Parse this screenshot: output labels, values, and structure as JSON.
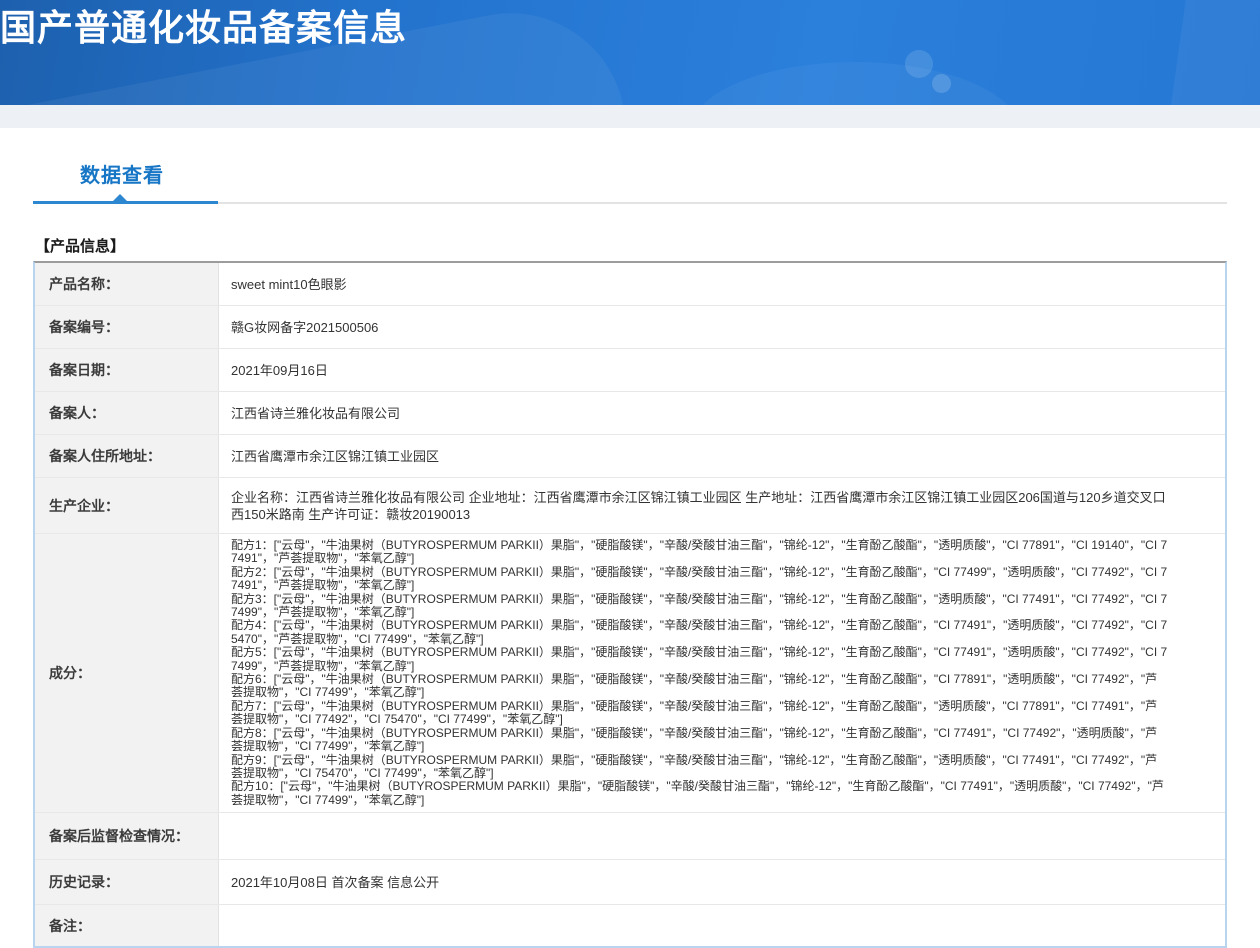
{
  "header": {
    "title": "国产普通化妆品备案信息"
  },
  "tabs": {
    "active_label": "数据查看"
  },
  "section": {
    "title": "【产品信息】"
  },
  "product_table": {
    "rows": [
      {
        "label": "产品名称：",
        "value": "sweet mint10色眼影"
      },
      {
        "label": "备案编号：",
        "value": "赣G妆网备字2021500506"
      },
      {
        "label": "备案日期：",
        "value": "2021年09月16日"
      },
      {
        "label": "备案人：",
        "value": "江西省诗兰雅化妆品有限公司"
      },
      {
        "label": "备案人住所地址：",
        "value": "江西省鹰潭市余江区锦江镇工业园区"
      },
      {
        "label": "生产企业：",
        "value": "企业名称：江西省诗兰雅化妆品有限公司 企业地址：江西省鹰潭市余江区锦江镇工业园区 生产地址：江西省鹰潭市余江区锦江镇工业园区206国道与120乡道交叉口西150米路南 生产许可证：赣妆20190013"
      },
      {
        "label": "成分：",
        "formulas": [
          "配方1：[\"云母\"，\"牛油果树（BUTYROSPERMUM PARKII）果脂\"，\"硬脂酸镁\"，\"辛酸/癸酸甘油三酯\"，\"锦纶-12\"，\"生育酚乙酸酯\"，\"透明质酸\"，\"CI 77891\"，\"CI 19140\"，\"CI 77491\"，\"芦荟提取物\"，\"苯氧乙醇\"]",
          "配方2：[\"云母\"，\"牛油果树（BUTYROSPERMUM PARKII）果脂\"，\"硬脂酸镁\"，\"辛酸/癸酸甘油三酯\"，\"锦纶-12\"，\"生育酚乙酸酯\"，\"CI 77499\"，\"透明质酸\"，\"CI 77492\"，\"CI 77491\"，\"芦荟提取物\"，\"苯氧乙醇\"]",
          "配方3：[\"云母\"，\"牛油果树（BUTYROSPERMUM PARKII）果脂\"，\"硬脂酸镁\"，\"辛酸/癸酸甘油三酯\"，\"锦纶-12\"，\"生育酚乙酸酯\"，\"透明质酸\"，\"CI 77491\"，\"CI 77492\"，\"CI 77499\"，\"芦荟提取物\"，\"苯氧乙醇\"]",
          "配方4：[\"云母\"，\"牛油果树（BUTYROSPERMUM PARKII）果脂\"，\"硬脂酸镁\"，\"辛酸/癸酸甘油三酯\"，\"锦纶-12\"，\"生育酚乙酸酯\"，\"CI 77491\"，\"透明质酸\"，\"CI 77492\"，\"CI 75470\"，\"芦荟提取物\"，\"CI 77499\"，\"苯氧乙醇\"]",
          "配方5：[\"云母\"，\"牛油果树（BUTYROSPERMUM PARKII）果脂\"，\"硬脂酸镁\"，\"辛酸/癸酸甘油三酯\"，\"锦纶-12\"，\"生育酚乙酸酯\"，\"CI 77491\"，\"透明质酸\"，\"CI 77492\"，\"CI 77499\"，\"芦荟提取物\"，\"苯氧乙醇\"]",
          "配方6：[\"云母\"，\"牛油果树（BUTYROSPERMUM PARKII）果脂\"，\"硬脂酸镁\"，\"辛酸/癸酸甘油三酯\"，\"锦纶-12\"，\"生育酚乙酸酯\"，\"CI 77891\"，\"透明质酸\"，\"CI 77492\"，\"芦荟提取物\"，\"CI 77499\"，\"苯氧乙醇\"]",
          "配方7：[\"云母\"，\"牛油果树（BUTYROSPERMUM PARKII）果脂\"，\"硬脂酸镁\"，\"辛酸/癸酸甘油三酯\"，\"锦纶-12\"，\"生育酚乙酸酯\"，\"透明质酸\"，\"CI 77891\"，\"CI 77491\"，\"芦荟提取物\"，\"CI 77492\"，\"CI 75470\"，\"CI 77499\"，\"苯氧乙醇\"]",
          "配方8：[\"云母\"，\"牛油果树（BUTYROSPERMUM PARKII）果脂\"，\"硬脂酸镁\"，\"辛酸/癸酸甘油三酯\"，\"锦纶-12\"，\"生育酚乙酸酯\"，\"CI 77491\"，\"CI 77492\"，\"透明质酸\"，\"芦荟提取物\"，\"CI 77499\"，\"苯氧乙醇\"]",
          "配方9：[\"云母\"，\"牛油果树（BUTYROSPERMUM PARKII）果脂\"，\"硬脂酸镁\"，\"辛酸/癸酸甘油三酯\"，\"锦纶-12\"，\"生育酚乙酸酯\"，\"透明质酸\"，\"CI 77491\"，\"CI 77492\"，\"芦荟提取物\"，\"CI 75470\"，\"CI 77499\"，\"苯氧乙醇\"]",
          "配方10：[\"云母\"，\"牛油果树（BUTYROSPERMUM PARKII）果脂\"，\"硬脂酸镁\"，\"辛酸/癸酸甘油三酯\"，\"锦纶-12\"，\"生育酚乙酸酯\"，\"CI 77491\"，\"透明质酸\"，\"CI 77492\"，\"芦荟提取物\"，\"CI 77499\"，\"苯氧乙醇\"]"
        ]
      },
      {
        "label": "备案后监督检查情况：",
        "value": ""
      },
      {
        "label": "历史记录：",
        "value": "2021年10月08日 首次备案 信息公开"
      },
      {
        "label": "备注：",
        "value": ""
      }
    ]
  },
  "colors": {
    "banner_gradient_start": "#1d60ae",
    "banner_gradient_end": "#2b80dc",
    "tab_blue": "#1776c5",
    "tab_rule_blue": "#2d87d0",
    "table_border_blue": "#b9d4ee",
    "table_border_top_gray": "#9c9c9c",
    "label_cell_bg": "#f2f2f2",
    "sub_strip_bg": "#edf1f6"
  }
}
